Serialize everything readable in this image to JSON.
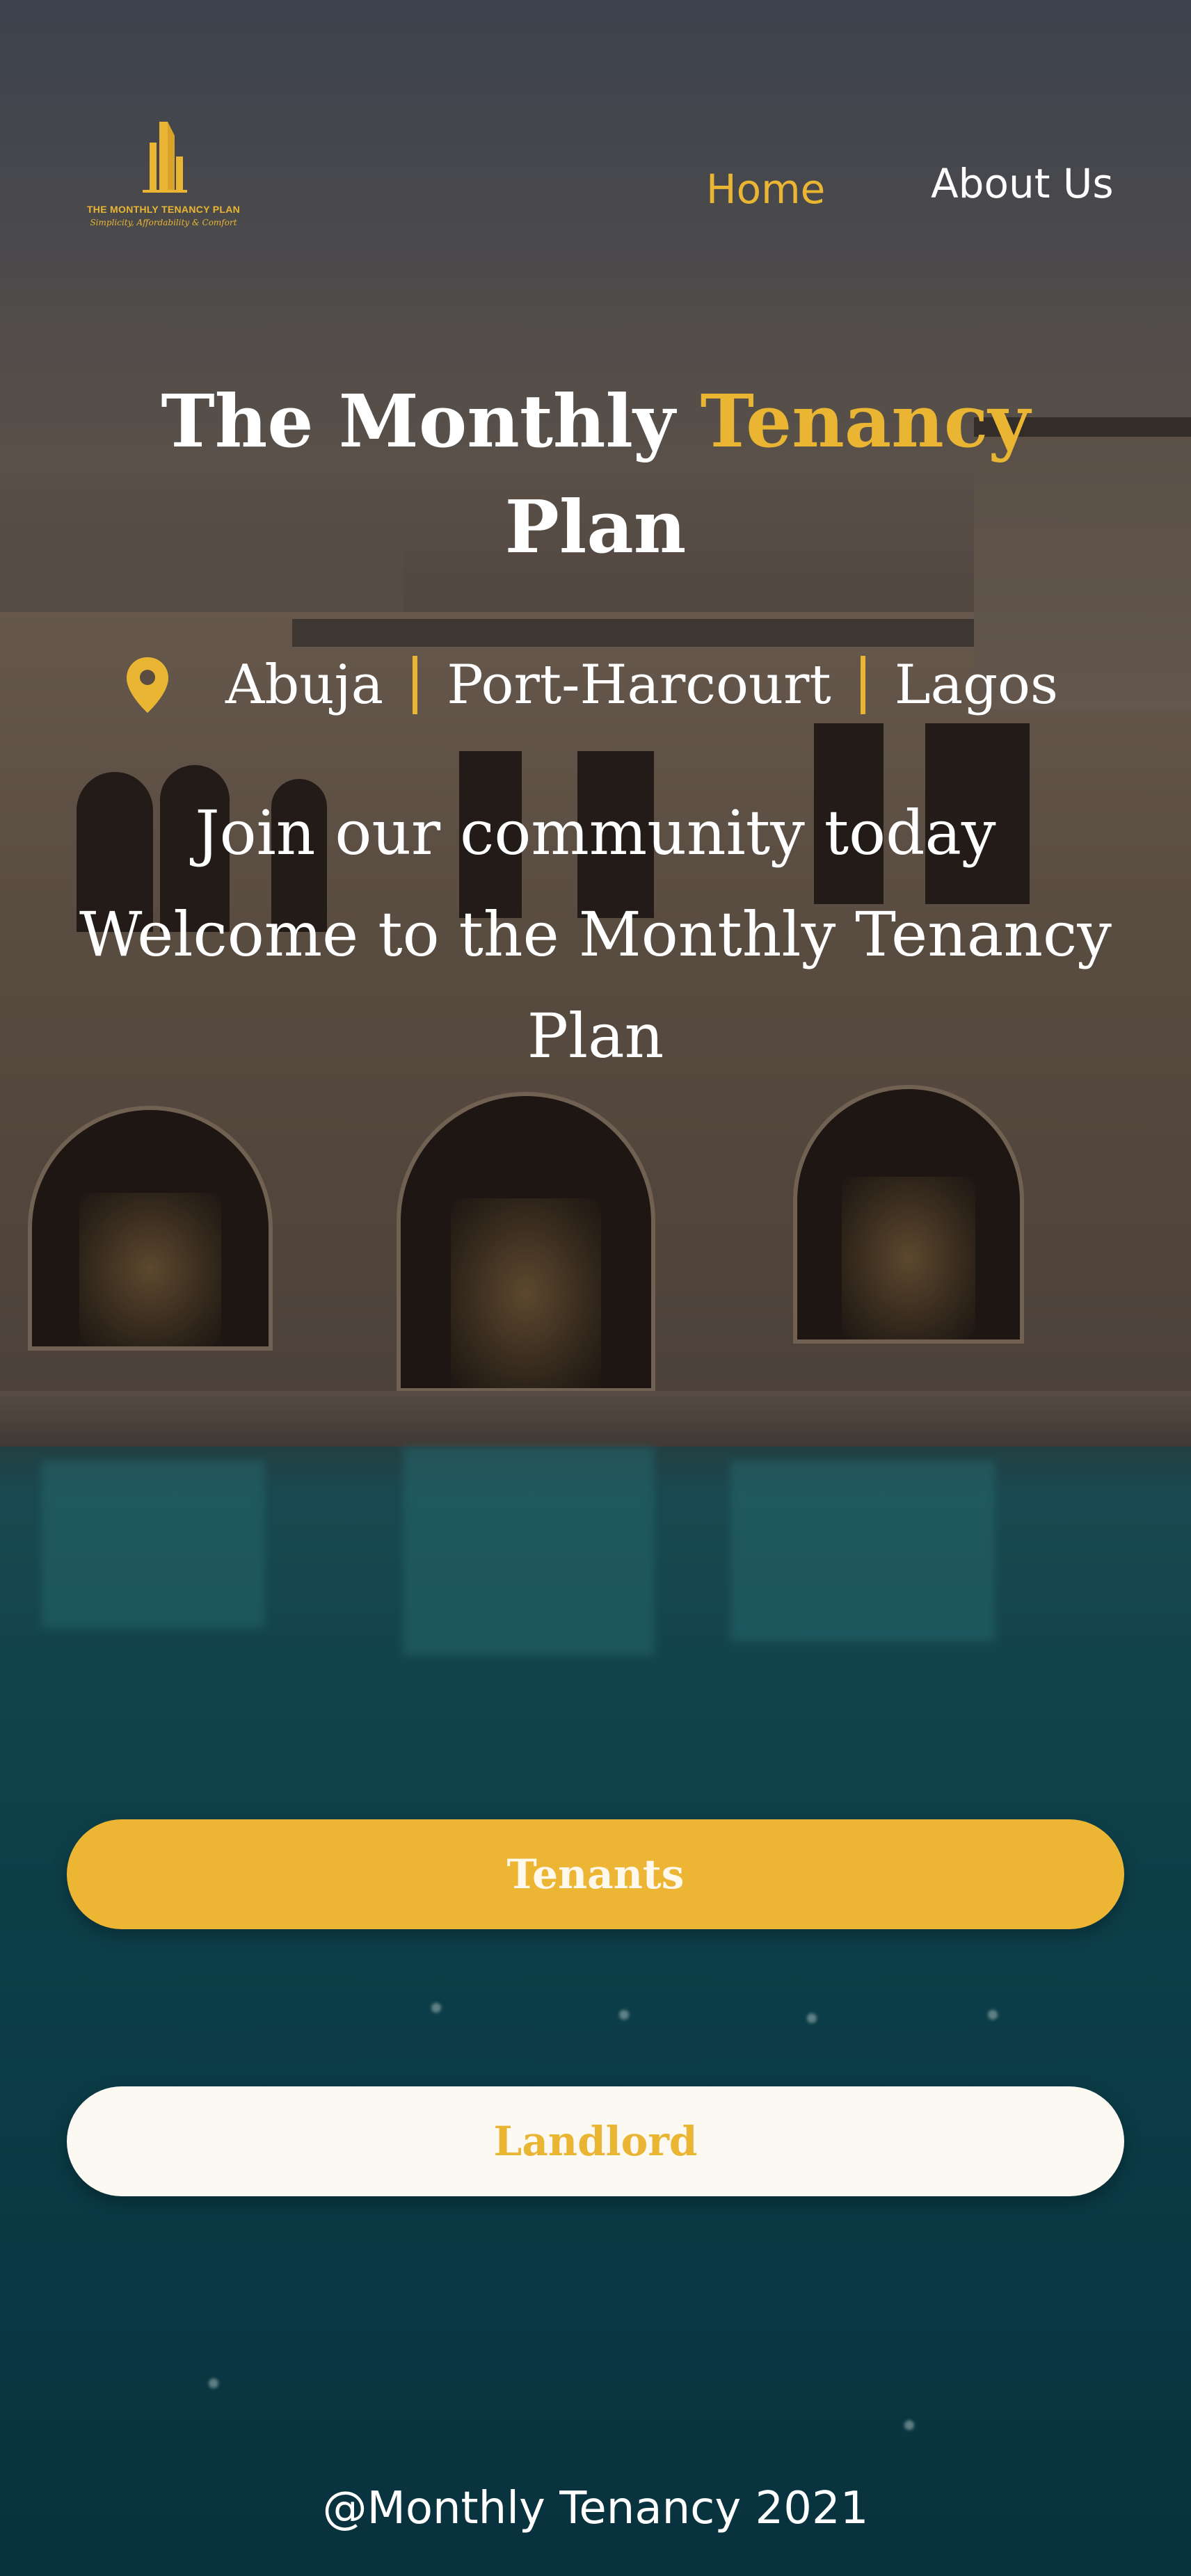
{
  "logo": {
    "title": "THE MONTHLY TENANCY PLAN",
    "tagline": "Simplicity, Affordability & Comfort"
  },
  "nav": {
    "home": "Home",
    "about": "About Us"
  },
  "hero": {
    "title_part1": "The Monthly ",
    "title_accent": "Tenancy",
    "title_part2": "Plan"
  },
  "locations": [
    "Abuja",
    "Port-Harcourt",
    "Lagos"
  ],
  "tagline": {
    "line1": "Join our community today",
    "line2": "Welcome to the Monthly Tenancy",
    "line3": "Plan"
  },
  "buttons": {
    "tenants": "Tenants",
    "landlord": "Landlord"
  },
  "footer": "@Monthly Tenancy 2021",
  "colors": {
    "accent": "#e9b533",
    "button_light": "#fcf9f2",
    "text": "#ffffff"
  }
}
